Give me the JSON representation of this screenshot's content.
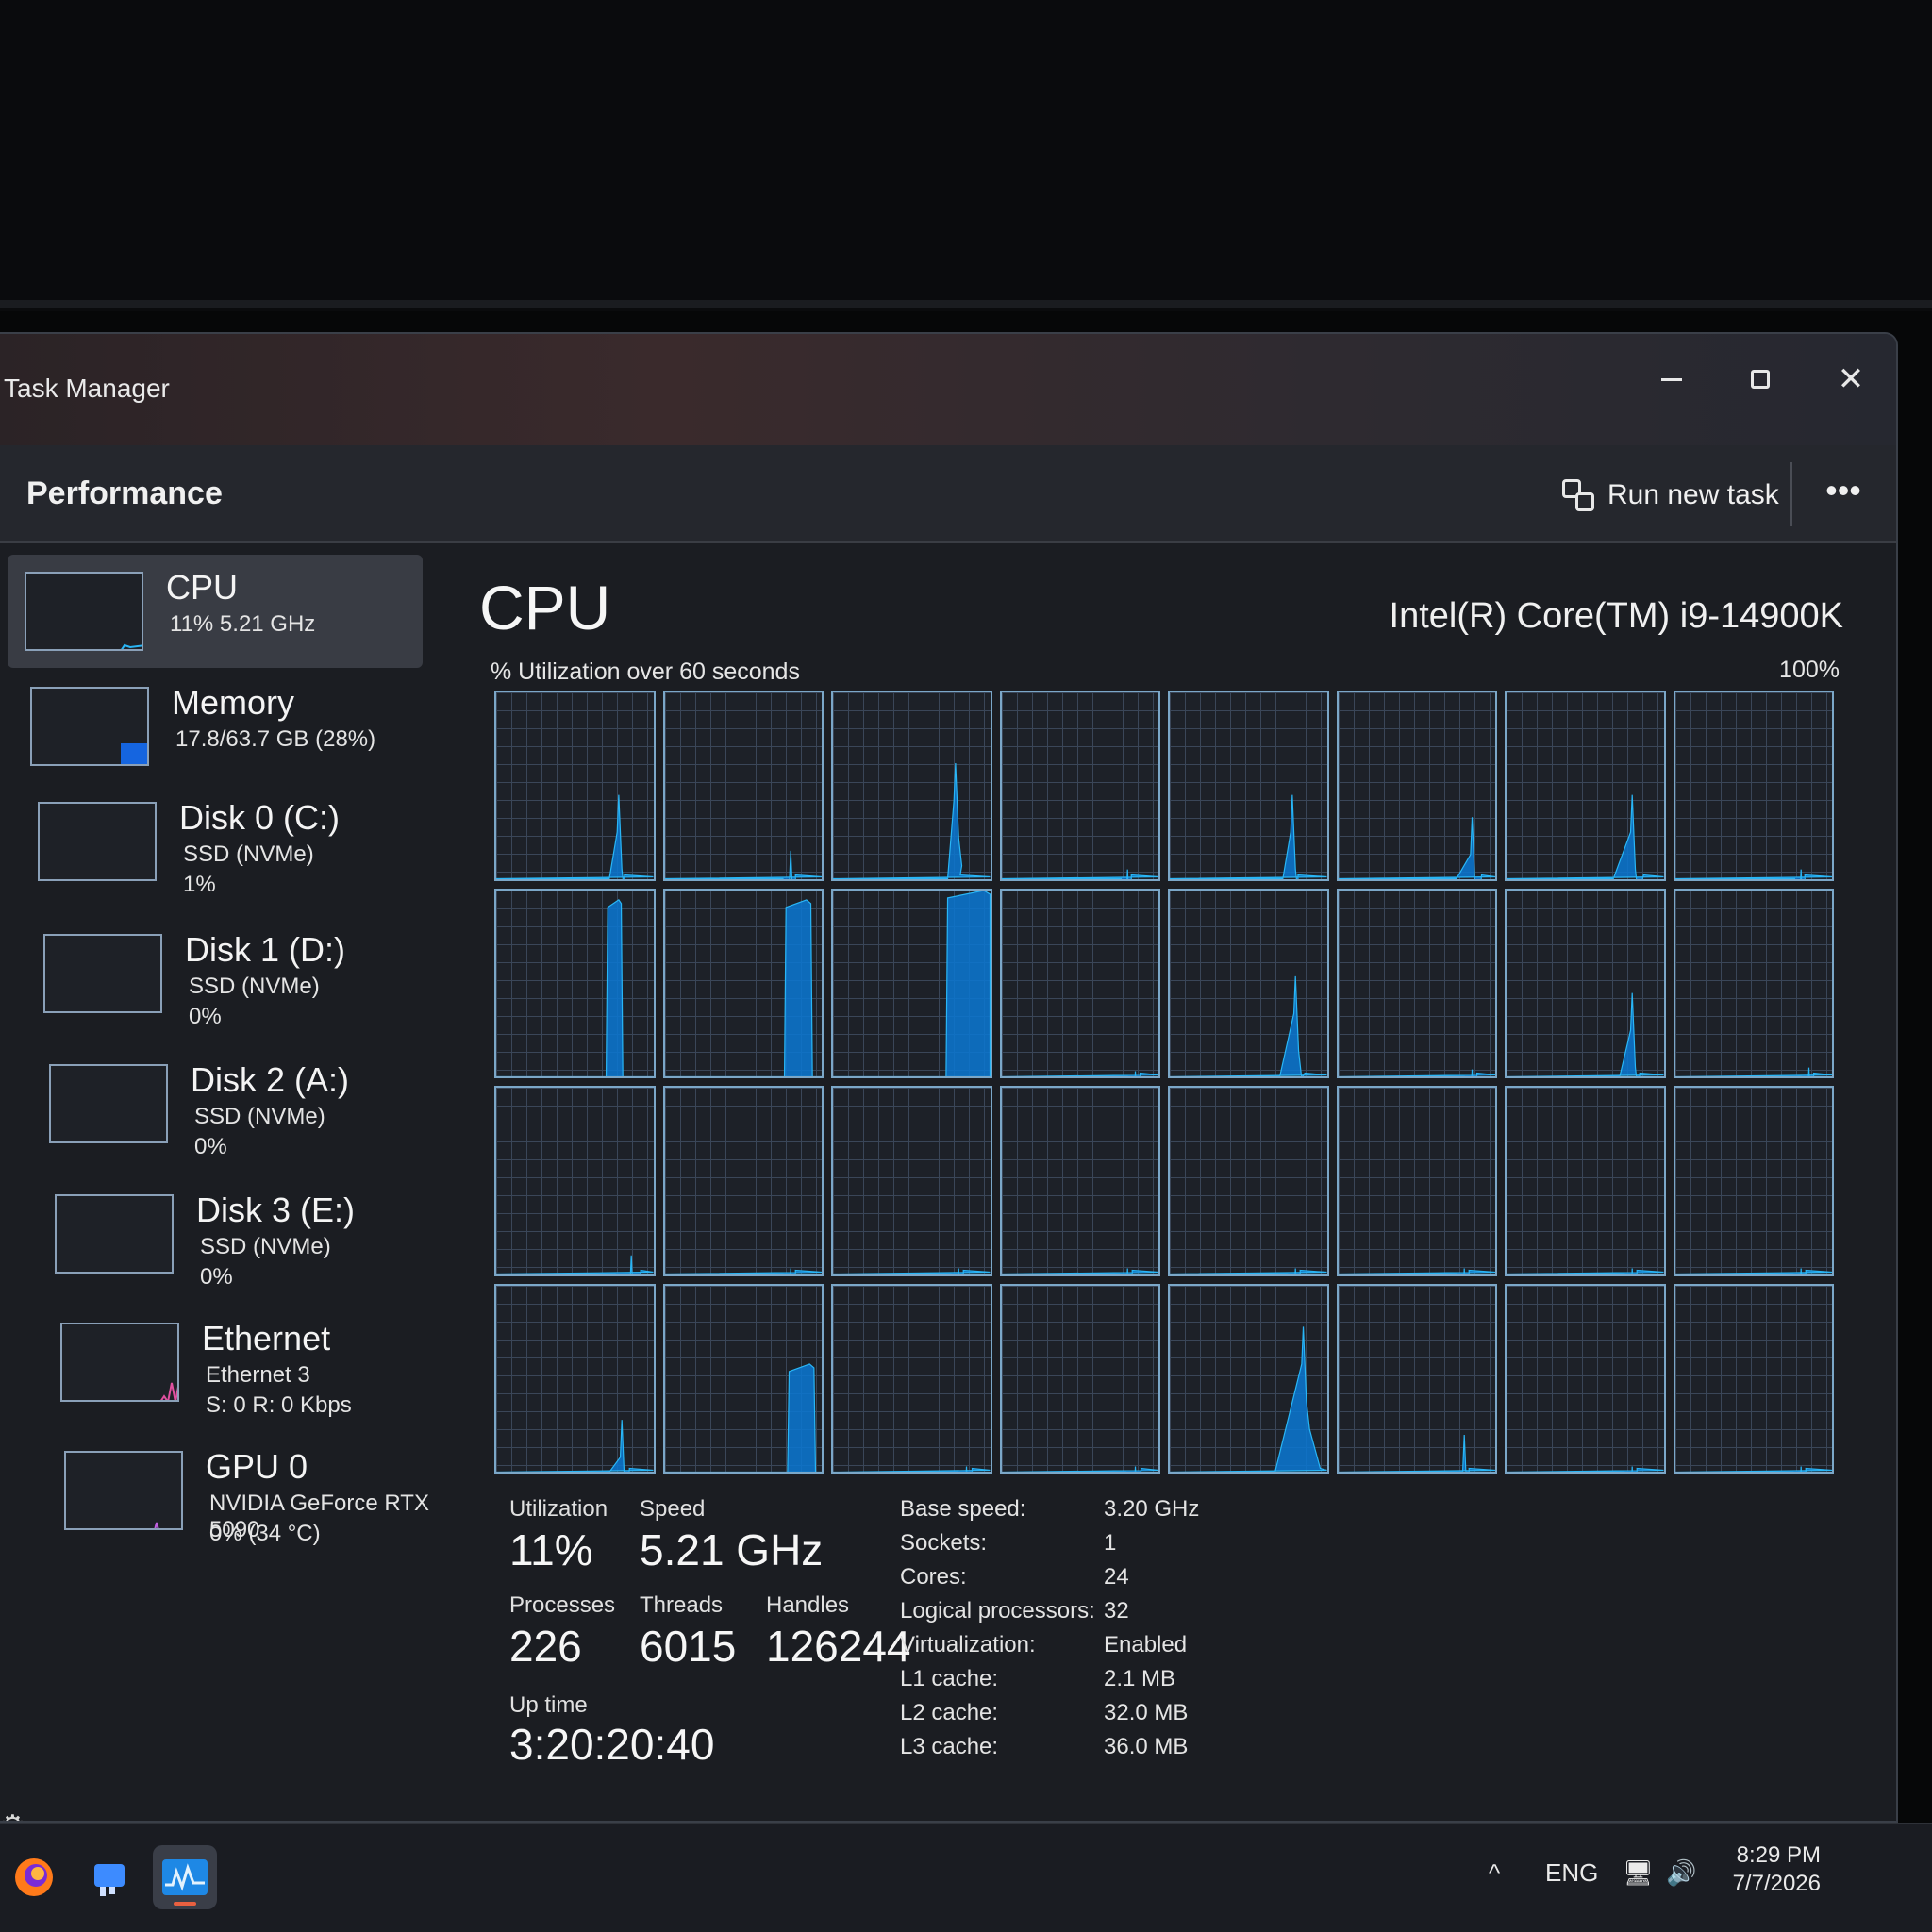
{
  "window": {
    "title": "Task Manager"
  },
  "header": {
    "page": "Performance",
    "run_new_task": "Run new task",
    "more": "•••"
  },
  "sidebar": {
    "items": [
      {
        "name": "CPU",
        "sub1": "11%  5.21 GHz",
        "sub2": ""
      },
      {
        "name": "Memory",
        "sub1": "17.8/63.7 GB (28%)",
        "sub2": ""
      },
      {
        "name": "Disk 0 (C:)",
        "sub1": "SSD (NVMe)",
        "sub2": "1%"
      },
      {
        "name": "Disk 1 (D:)",
        "sub1": "SSD (NVMe)",
        "sub2": "0%"
      },
      {
        "name": "Disk 2 (A:)",
        "sub1": "SSD (NVMe)",
        "sub2": "0%"
      },
      {
        "name": "Disk 3 (E:)",
        "sub1": "SSD (NVMe)",
        "sub2": "0%"
      },
      {
        "name": "Ethernet",
        "sub1": "Ethernet 3",
        "sub2": "S: 0 R: 0 Kbps"
      },
      {
        "name": "GPU 0",
        "sub1": "NVIDIA GeForce RTX 5090",
        "sub2": "0% (34 °C)"
      }
    ]
  },
  "main": {
    "title": "CPU",
    "model": "Intel(R) Core(TM) i9-14900K",
    "graph_label": "% Utilization over 60 seconds",
    "graph_max": "100%",
    "utilization_label": "Utilization",
    "utilization": "11%",
    "speed_label": "Speed",
    "speed": "5.21 GHz",
    "processes_label": "Processes",
    "processes": "226",
    "threads_label": "Threads",
    "threads": "6015",
    "handles_label": "Handles",
    "handles": "126244",
    "uptime_label": "Up time",
    "uptime": "3:20:20:40",
    "specs": [
      {
        "key": "Base speed:",
        "value": "3.20 GHz"
      },
      {
        "key": "Sockets:",
        "value": "1"
      },
      {
        "key": "Cores:",
        "value": "24"
      },
      {
        "key": "Logical processors:",
        "value": "32"
      },
      {
        "key": "Virtualization:",
        "value": "Enabled"
      },
      {
        "key": "L1 cache:",
        "value": "2.1 MB"
      },
      {
        "key": "L2 cache:",
        "value": "32.0 MB"
      },
      {
        "key": "L3 cache:",
        "value": "36.0 MB"
      }
    ]
  },
  "colors": {
    "cpu_line": "#29b6f6",
    "cpu_fill": "#0a78d4",
    "memory": "#1565e0",
    "ethernet": "#e050a0",
    "gpu": "#c060e0"
  },
  "taskbar": {
    "apps": [
      "firefox-icon",
      "app-icon",
      "task-manager-icon"
    ],
    "tray": {
      "chevron": "^",
      "lang": "ENG"
    },
    "time": "8:29 PM",
    "date": "7/7/2026"
  }
}
